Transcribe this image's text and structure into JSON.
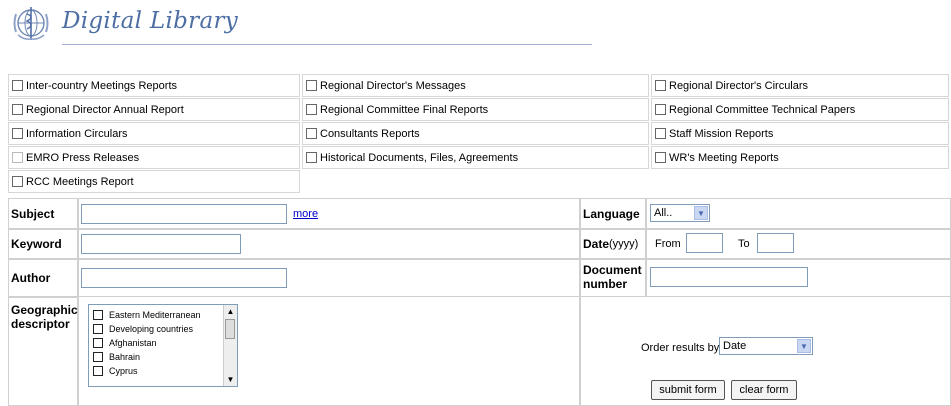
{
  "header": {
    "title": "Digital Library"
  },
  "categories": [
    [
      "Inter-country Meetings Reports",
      "Regional Director's Messages",
      "Regional Director's Circulars"
    ],
    [
      "Regional Director Annual Report",
      "Regional Committee Final Reports",
      "Regional Committee Technical Papers"
    ],
    [
      "Information Circulars",
      "Consultants Reports",
      "Staff Mission Reports"
    ],
    [
      "EMRO Press Releases",
      "Historical Documents, Files, Agreements",
      "WR's Meeting Reports"
    ],
    [
      "RCC Meetings Report"
    ]
  ],
  "form": {
    "subject_label": "Subject",
    "more_link": "more",
    "language_label": "Language",
    "language_value": "All..",
    "keyword_label": "Keyword",
    "date_label": "Date",
    "date_format": "(yyyy)",
    "from_label": "From",
    "to_label": "To",
    "author_label": "Author",
    "doc_label_line1": "Document",
    "doc_label_line2": "number",
    "geo_label_line1": "Geographic",
    "geo_label_line2": "descriptor",
    "geo_items": [
      "Eastern Mediterranean",
      "Developing countries",
      "Afghanistan",
      "Bahrain",
      "Cyprus"
    ],
    "order_label": "Order results by",
    "order_value": "Date",
    "submit_label": "submit form",
    "clear_label": "clear form"
  }
}
